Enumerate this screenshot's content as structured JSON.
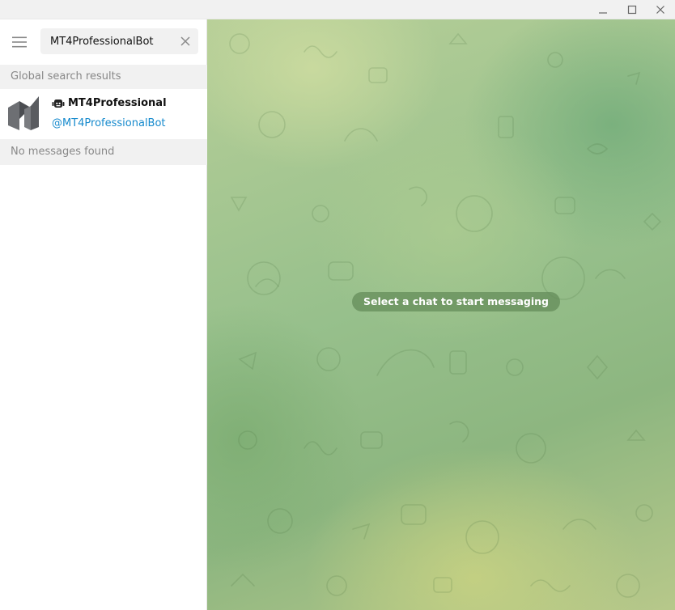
{
  "window": {
    "controls": [
      "minimize-icon",
      "maximize-icon",
      "close-icon"
    ]
  },
  "sidebar": {
    "menu_icon": "hamburger-menu-icon",
    "search": {
      "value": "MT4ProfessionalBot",
      "placeholder": "Search",
      "clear_icon": "close-icon"
    },
    "global_results_header": "Global search results",
    "results": [
      {
        "name": "MT4Professional",
        "username": "@MT4ProfessionalBot",
        "badge_icon": "bot-icon",
        "avatar_icon": "mt4-logo"
      }
    ],
    "messages_header": "No messages found"
  },
  "chat": {
    "empty_state": "Select a chat to start messaging",
    "accent_link_color": "#168acd"
  }
}
